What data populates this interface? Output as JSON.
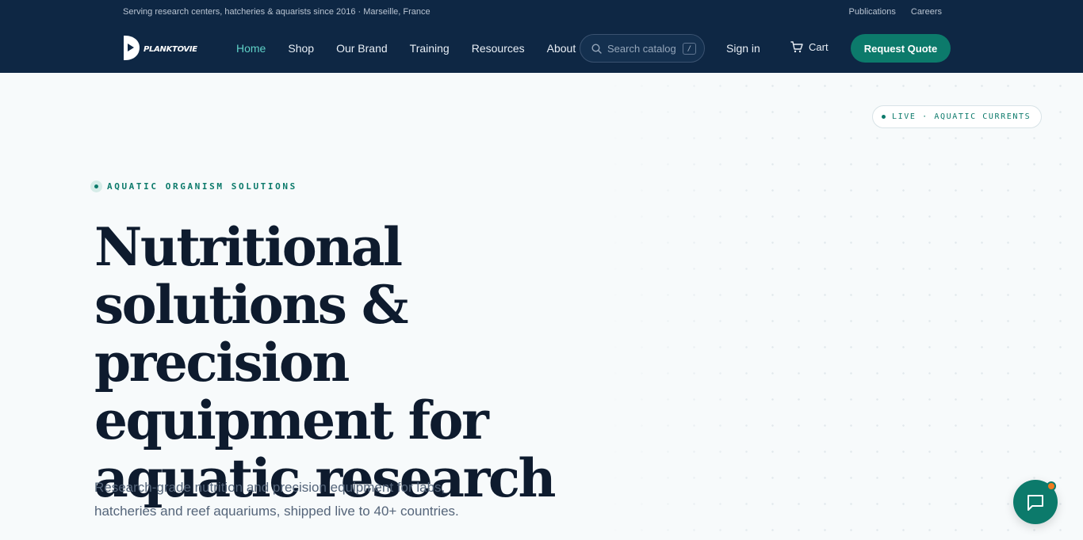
{
  "utility": {
    "tagline": "Serving research centers, hatcheries & aquarists since 2016 · Marseille, France",
    "links": [
      "Publications",
      "Careers"
    ]
  },
  "brand": {
    "logo_text": "PLANKTOVIE"
  },
  "nav": {
    "items": [
      "Home",
      "Shop",
      "Our Brand",
      "Training",
      "Resources",
      "About"
    ],
    "active": "Home"
  },
  "search": {
    "placeholder": "Search catalog",
    "shortcut": "/"
  },
  "header": {
    "signin_label": "Sign in",
    "cart_label": "Cart",
    "quote_label": "Request Quote"
  },
  "hero": {
    "live_badge": "LIVE · AQUATIC CURRENTS",
    "eyebrow": "AQUATIC ORGANISM SOLUTIONS",
    "headline": "Nutritional solutions & precision equipment for aquatic research",
    "subhead": "Research-grade nutrition and precision equipment for labs, hatcheries and reef aquariums, shipped live to 40+ countries."
  },
  "colors": {
    "navy": "#0e2744",
    "accent": "#0c7a6b",
    "nav_active": "#5fd1c7",
    "notification": "#f07a1e"
  },
  "icons": {
    "search": "search-icon",
    "cart": "cart-icon",
    "chat": "chat-icon",
    "logo": "logo-icon"
  }
}
